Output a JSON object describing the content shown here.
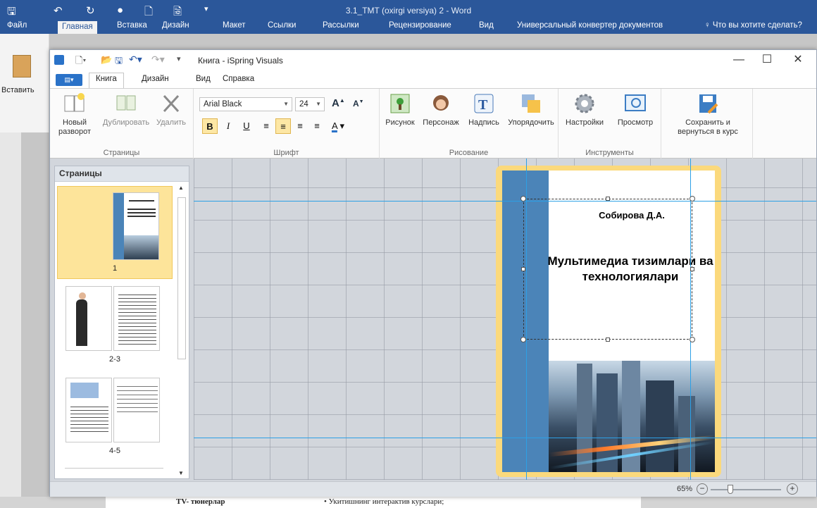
{
  "word": {
    "window_title": "3.1_TMT  (oxirgi versiya) 2 - Word",
    "tabs": [
      "Файл",
      "Главная",
      "Вставка",
      "Дизайн",
      "Макет",
      "Ссылки",
      "Рассылки",
      "Рецензирование",
      "Вид",
      "Универсальный конвертер документов"
    ],
    "active_tab": "Главная",
    "tell_me": "Что вы хотите сделать?",
    "paste_label": "Вставить",
    "doc_line_left": "TV- тюнерлар",
    "doc_line_right": "•  Укитишнинг  интерактив курслари;"
  },
  "ispring": {
    "title": "Книга - iSpring Visuals",
    "tabs": [
      "Книга",
      "Дизайн",
      "Вид",
      "Справка"
    ],
    "active_tab": "Книга",
    "ribbon": {
      "pages": {
        "label": "Страницы",
        "new_spread": "Новый разворот",
        "duplicate": "Дублировать",
        "delete": "Удалить"
      },
      "font": {
        "label": "Шрифт",
        "family": "Arial Black",
        "size": "24",
        "bold": "B",
        "italic": "I",
        "underline": "U"
      },
      "drawing": {
        "label": "Рисование",
        "picture": "Рисунок",
        "character": "Персонаж",
        "caption": "Надпись",
        "arrange": "Упорядочить"
      },
      "tools": {
        "label": "Инструменты",
        "settings": "Настройки",
        "preview": "Просмотр"
      },
      "save": "Сохранить и вернуться в курс"
    },
    "pages_panel": {
      "header": "Страницы",
      "thumbs": [
        {
          "label": "1"
        },
        {
          "label": "2-3"
        },
        {
          "label": "4-5"
        }
      ]
    },
    "cover": {
      "author": "Собирова Д.А.",
      "title": "Мультимедиа тизимлари ва технологиялари"
    },
    "zoom": "65%"
  },
  "colors": {
    "word_blue": "#2b579a",
    "spine_blue": "#4b84b8",
    "book_border": "#fbd97c",
    "selection": "#fde49a",
    "guide": "#2ca0e6"
  }
}
